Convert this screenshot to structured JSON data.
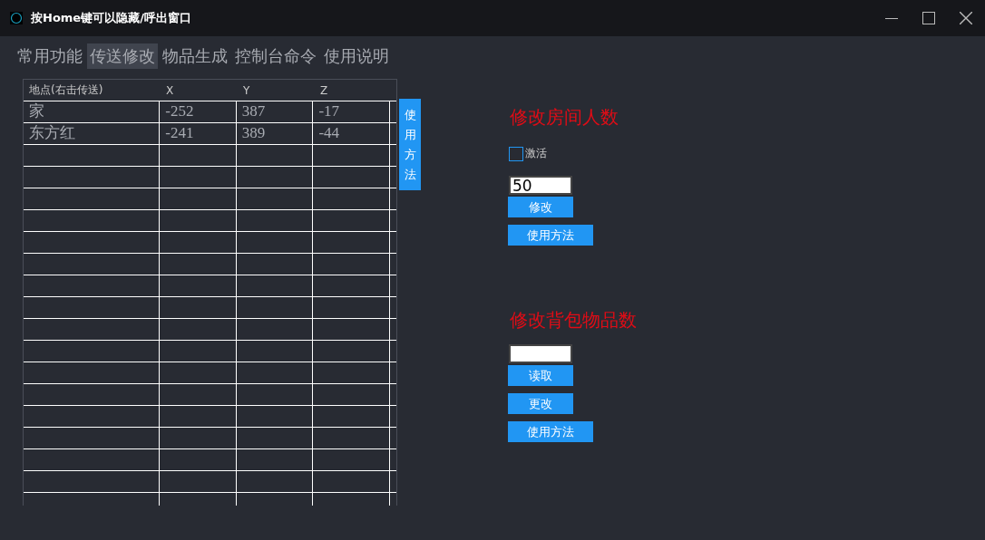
{
  "window": {
    "title": "按Home键可以隐藏/呼出窗口"
  },
  "tabs": [
    {
      "label": "常用功能",
      "selected": false
    },
    {
      "label": "传送修改",
      "selected": true
    },
    {
      "label": "物品生成",
      "selected": false
    },
    {
      "label": "控制台命令",
      "selected": false
    },
    {
      "label": "使用说明",
      "selected": false
    }
  ],
  "table": {
    "columns": [
      "地点(右击传送)",
      "X",
      "Y",
      "Z"
    ],
    "rows": [
      [
        "家",
        "-252",
        "387",
        "-17"
      ],
      [
        "东方红",
        "-241",
        "389",
        "-44"
      ]
    ]
  },
  "side_button": "使用方法",
  "room": {
    "title": "修改房间人数",
    "checkbox": {
      "label": "激活",
      "checked": false
    },
    "value": "50",
    "buttons": [
      "修改",
      "使用方法"
    ]
  },
  "bag": {
    "title": "修改背包物品数",
    "buttons": [
      "读取",
      "更改",
      "使用方法"
    ]
  }
}
